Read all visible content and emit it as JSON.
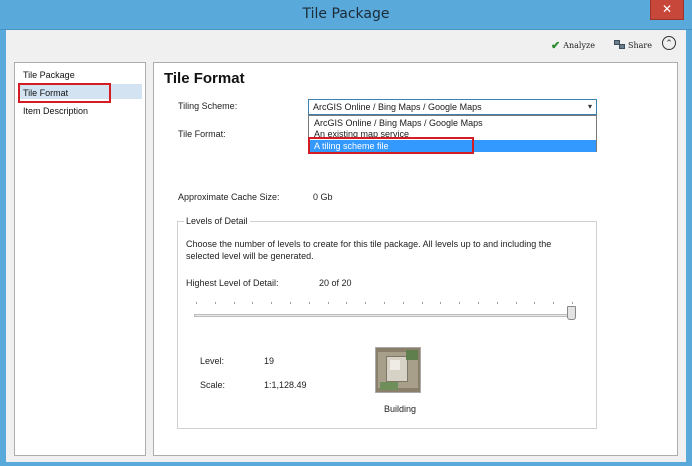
{
  "window": {
    "title": "Tile Package",
    "close_glyph": "✕"
  },
  "toolbar": {
    "analyze_label": "Analyze",
    "analyze_icon": "checkmark-icon",
    "share_label": "Share",
    "share_icon": "share-icon",
    "collapse_glyph": "⌃"
  },
  "sidebar": {
    "items": [
      {
        "label": "Tile Package"
      },
      {
        "label": "Tile Format",
        "active": true
      },
      {
        "label": "Item Description"
      }
    ]
  },
  "main": {
    "title": "Tile Format",
    "tiling_scheme_label": "Tiling Scheme:",
    "tiling_scheme_value": "ArcGIS Online / Bing Maps / Google Maps",
    "tiling_scheme_options": [
      "ArcGIS Online / Bing Maps / Google Maps",
      "An existing map service",
      "A tiling scheme file"
    ],
    "highlighted_option_index": 2,
    "tile_format_label": "Tile Format:",
    "cache_size_label": "Approximate Cache Size:",
    "cache_size_value": "0 Gb",
    "lod": {
      "group_title": "Levels of Detail",
      "description": "Choose the number of levels to create for this tile package.  All levels up to and including the selected level will be generated.",
      "highest_label": "Highest Level of Detail:",
      "highest_value": "20 of 20",
      "slider_value": 20,
      "slider_max": 20,
      "level_label": "Level:",
      "level_value": "19",
      "scale_label": "Scale:",
      "scale_value": "1:1,128.49",
      "preview_caption": "Building"
    }
  },
  "colors": {
    "title_bar": "#5aa9db",
    "selection": "#3399ff",
    "highlight_box": "#d41c24"
  }
}
